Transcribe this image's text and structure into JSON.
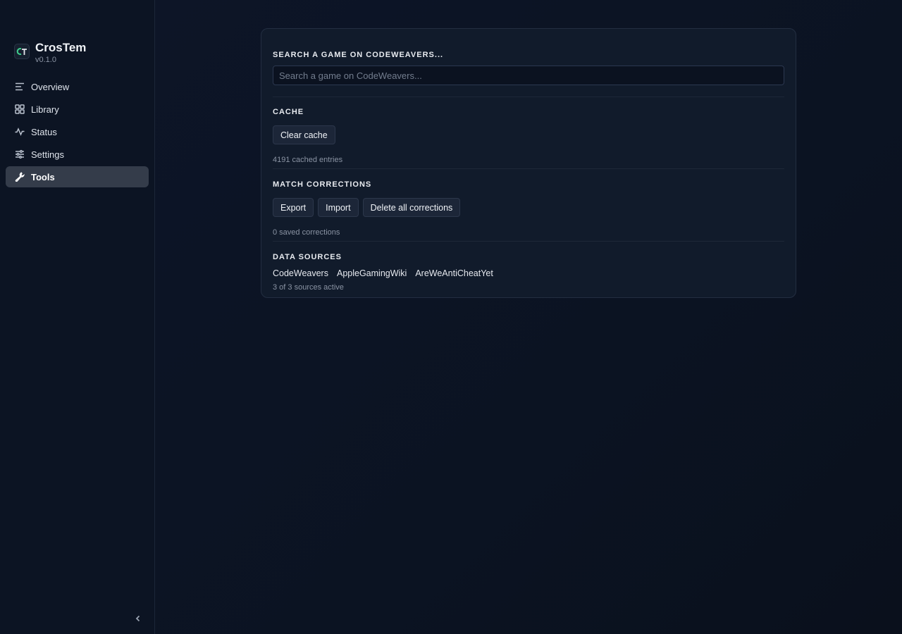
{
  "app": {
    "name": "CrosTem",
    "version": "v0.1.0",
    "logo_text": "CT"
  },
  "sidebar": {
    "items": [
      {
        "label": "Overview",
        "icon": "overview-icon",
        "active": false
      },
      {
        "label": "Library",
        "icon": "grid-icon",
        "active": false
      },
      {
        "label": "Status",
        "icon": "activity-icon",
        "active": false
      },
      {
        "label": "Settings",
        "icon": "sliders-icon",
        "active": false
      },
      {
        "label": "Tools",
        "icon": "wrench-icon",
        "active": true
      }
    ],
    "collapse_icon": "chevron-left-icon"
  },
  "tools": {
    "search": {
      "title": "SEARCH A GAME ON CODEWEAVERS...",
      "placeholder": "Search a game on CodeWeavers...",
      "value": ""
    },
    "cache": {
      "title": "CACHE",
      "clear_label": "Clear cache",
      "entries_text": "4191 cached entries"
    },
    "corrections": {
      "title": "MATCH CORRECTIONS",
      "export_label": "Export",
      "import_label": "Import",
      "delete_label": "Delete all corrections",
      "saved_text": "0 saved corrections"
    },
    "data_sources": {
      "title": "DATA SOURCES",
      "items": [
        "CodeWeavers",
        "AppleGamingWiki",
        "AreWeAntiCheatYet"
      ],
      "active_text": "3 of 3 sources active"
    }
  },
  "colors": {
    "background": "#0b1220",
    "panel": "#111b2b",
    "active_nav": "#343c4a",
    "logo_accent": "#3ecf8e"
  }
}
